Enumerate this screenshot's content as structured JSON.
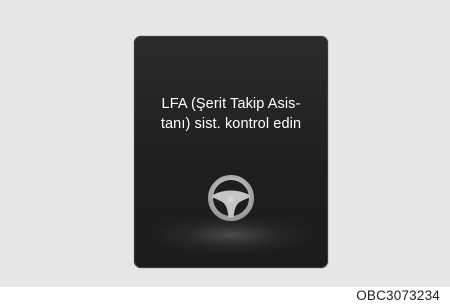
{
  "display": {
    "message_line_1": "LFA (Şerit Takip Asis-",
    "message_line_2": "tanı) sist. kontrol edin",
    "icon": "steering-wheel-icon"
  },
  "figure": {
    "code": "OBC3073234"
  },
  "colors": {
    "background": "#e6e6e6",
    "screen": "#1f1f1f",
    "text": "#ffffff",
    "icon": "#b5b5b5"
  }
}
